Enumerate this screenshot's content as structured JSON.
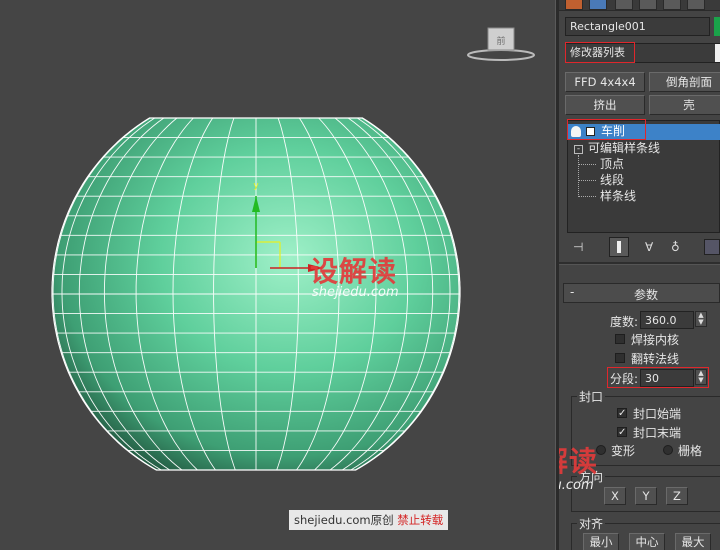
{
  "viewport": {
    "viewcube_label": "前",
    "mesh_color": "#5fcf9c",
    "wire_color": "#ffffff"
  },
  "panel": {
    "object_name": "Rectangle001",
    "modifier_list": "修改器列表",
    "buttons": [
      "FFD 4x4x4",
      "倒角剖面",
      "挤出",
      "壳"
    ],
    "stack": {
      "top_item": "车削",
      "base_item": "可编辑样条线",
      "sub_items": [
        "顶点",
        "线段",
        "样条线"
      ]
    },
    "rollout": {
      "title": "参数",
      "collapse_sign": "-",
      "degrees_label": "度数:",
      "degrees_value": "360.0",
      "weld_core": "焊接内核",
      "flip_normals": "翻转法线",
      "segments_label": "分段:",
      "segments_value": "30",
      "capping_group": "封口",
      "cap_start": "封口始端",
      "cap_end": "封口末端",
      "morph": "变形",
      "grid": "栅格",
      "direction_group": "方向",
      "dir_x": "X",
      "dir_y": "Y",
      "dir_z": "Z",
      "align_group": "对齐",
      "align_min": "最小",
      "align_center": "中心",
      "align_max": "最大"
    },
    "accent_color": "#e0272c",
    "selected_row_color": "#3d82c8"
  },
  "watermark": {
    "brand_cn": "设解读",
    "url": "shejiedu.com",
    "credit_prefix": "shejiedu.com原创",
    "credit_warning": "禁止转载"
  }
}
